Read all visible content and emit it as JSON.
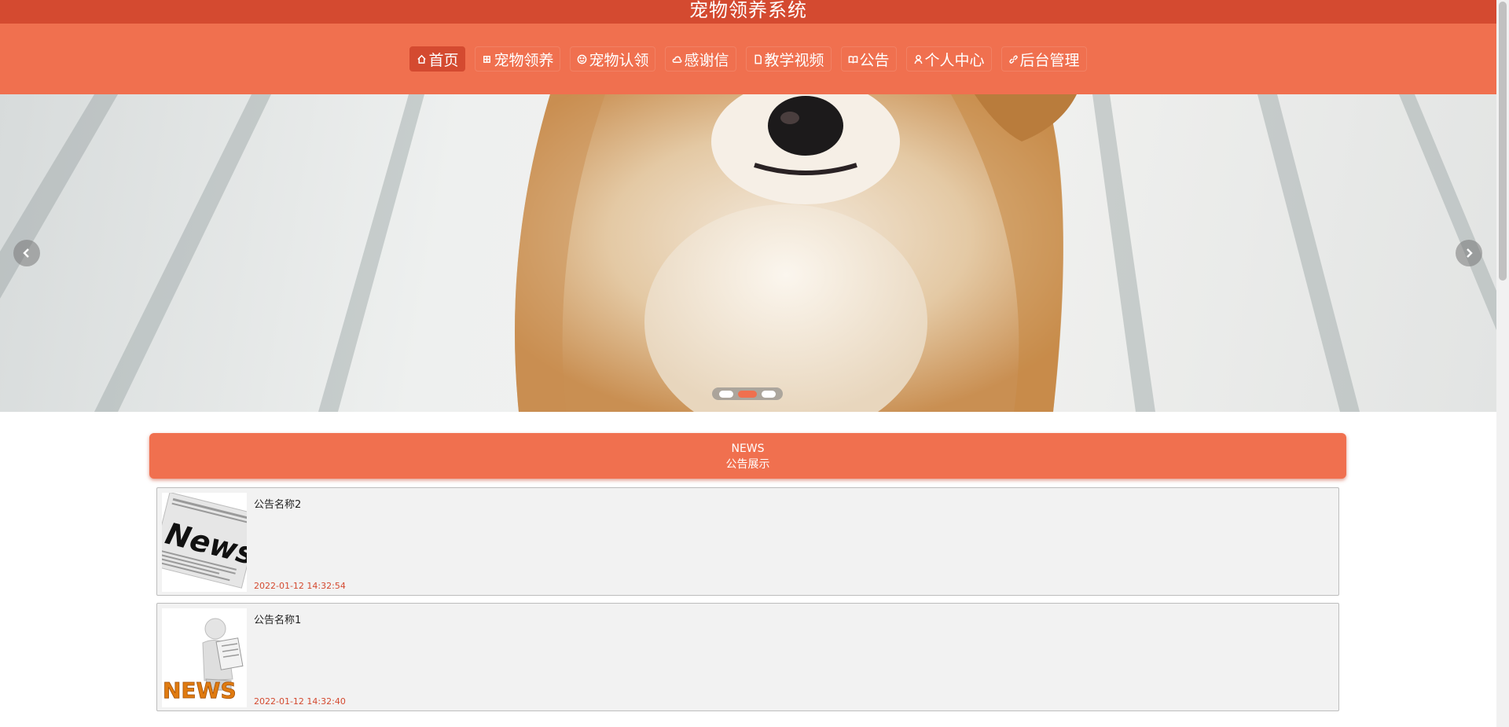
{
  "header": {
    "title": "宠物领养系统"
  },
  "nav": {
    "items": [
      {
        "label": "首页",
        "icon": "home-icon"
      },
      {
        "label": "宠物领养",
        "icon": "grid-icon"
      },
      {
        "label": "宠物认领",
        "icon": "smile-icon"
      },
      {
        "label": "感谢信",
        "icon": "cloud-icon"
      },
      {
        "label": "教学视频",
        "icon": "document-icon"
      },
      {
        "label": "公告",
        "icon": "book-icon"
      },
      {
        "label": "个人中心",
        "icon": "user-icon"
      },
      {
        "label": "后台管理",
        "icon": "link-icon"
      }
    ],
    "active_index": 0
  },
  "banner": {
    "image": "puppy-photo",
    "slide_count": 3,
    "active_slide": 1
  },
  "news": {
    "heading_en": "NEWS",
    "heading_cn": "公告展示",
    "items": [
      {
        "title": "公告名称2",
        "date": "2022-01-12 14:32:54",
        "thumbnail": "news-newspaper-image"
      },
      {
        "title": "公告名称1",
        "date": "2022-01-12 14:32:40",
        "thumbnail": "news-reader-figure-image"
      }
    ]
  },
  "colors": {
    "title_bar": "#d44a30",
    "nav_bar": "#f0704f",
    "accent": "#f0704f",
    "date_text": "#d44a30"
  }
}
